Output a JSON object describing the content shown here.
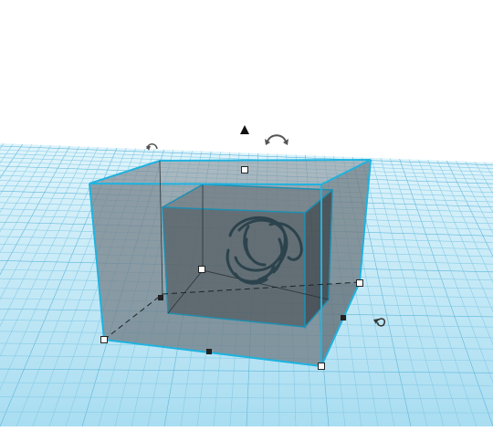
{
  "scene": {
    "workplane_color": "#bde7f5",
    "grid_color": "#7fc7e4",
    "grid_major_color": "#58b2d8",
    "outer_box_color": "#6b7780",
    "inner_box_color": "#4b5358",
    "selection_outline_color": "#22b7e3",
    "imported_model_color": "#2f4650"
  },
  "icons": {
    "rotate_top": "rotate-arrow-icon",
    "rotate_left": "rotate-arrow-icon",
    "rotate_right": "rotate-arrow-icon",
    "lift": "lift-cone-icon"
  }
}
